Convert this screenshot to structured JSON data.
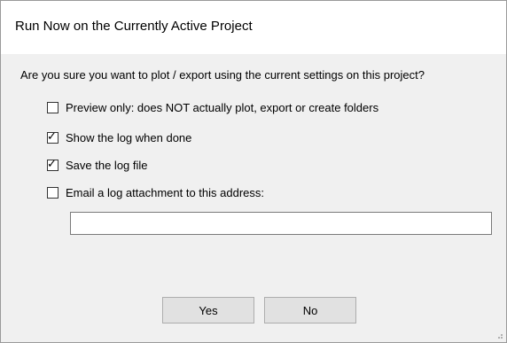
{
  "dialog": {
    "title": "Run Now on the Currently Active Project",
    "question": "Are you sure you want to plot / export using the current settings on this project?"
  },
  "options": [
    {
      "label": "Preview only:  does NOT actually plot, export or create folders",
      "checked": false
    },
    {
      "label": "Show the log when done",
      "checked": true
    },
    {
      "label": "Save the log file",
      "checked": true
    },
    {
      "label": "Email a log attachment to this address:",
      "checked": false
    }
  ],
  "email": {
    "value": "",
    "placeholder": ""
  },
  "buttons": {
    "yes": "Yes",
    "no": "No"
  }
}
